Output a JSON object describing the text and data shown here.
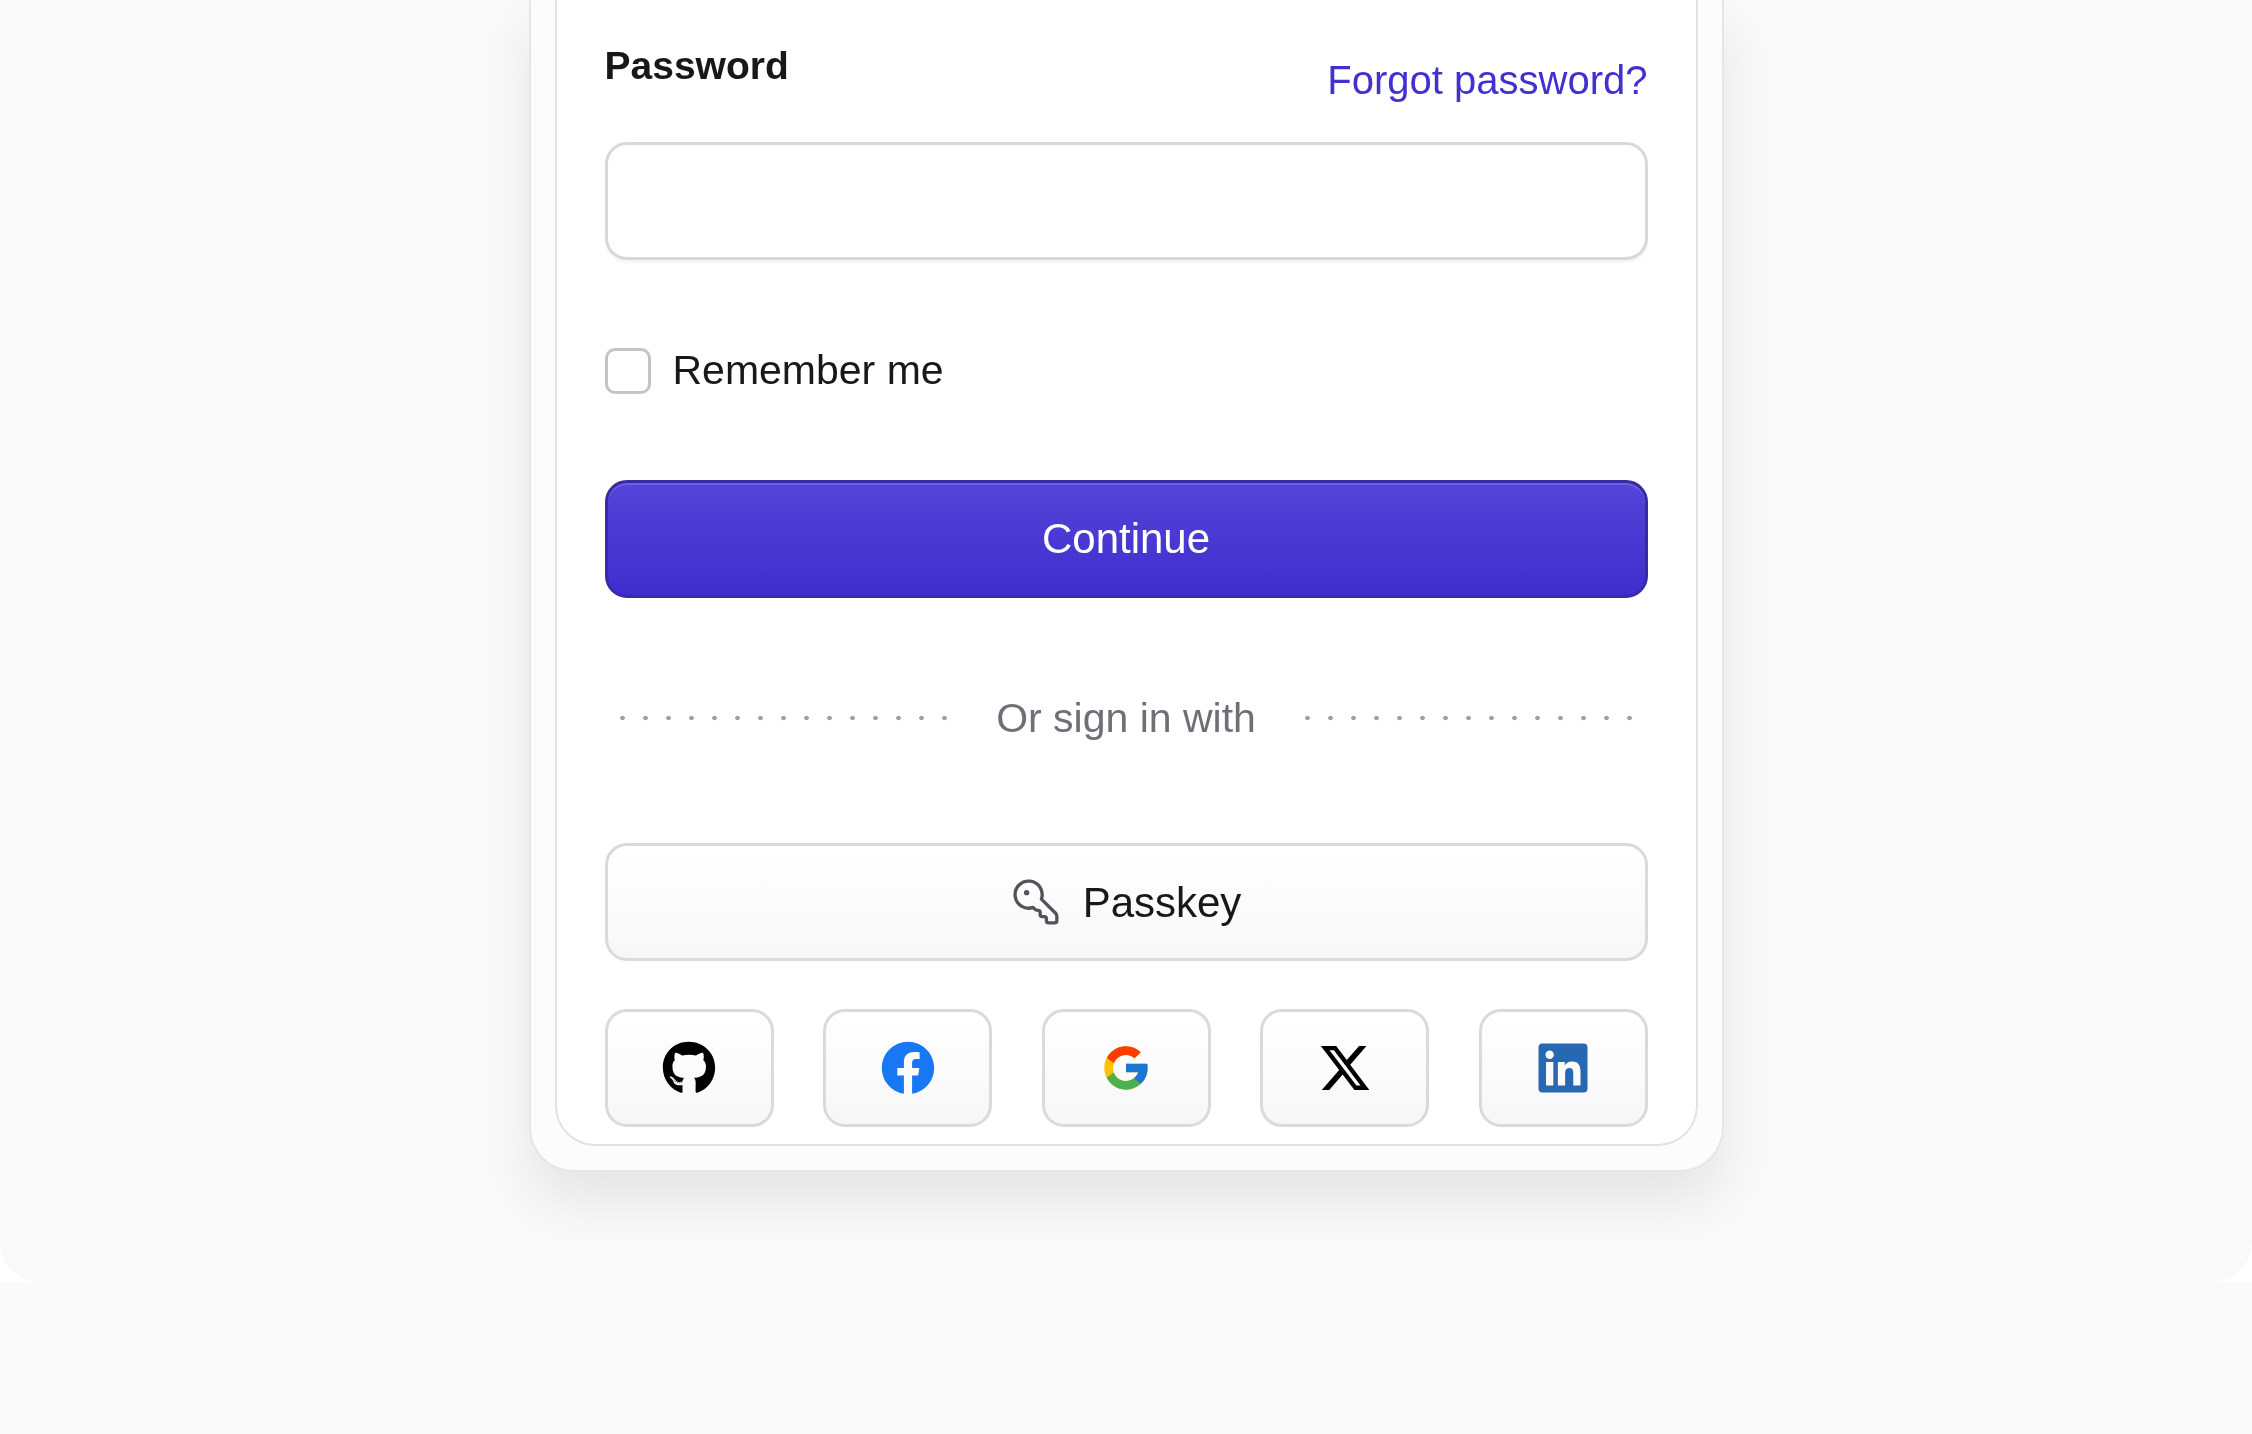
{
  "password": {
    "label": "Password",
    "forgot_link": "Forgot password?"
  },
  "remember": {
    "label": "Remember me",
    "checked": false
  },
  "continue_button": {
    "label": "Continue"
  },
  "divider": {
    "label": "Or sign in with"
  },
  "passkey_button": {
    "label": "Passkey"
  },
  "social_buttons": [
    {
      "kind": "github"
    },
    {
      "kind": "facebook"
    },
    {
      "kind": "google"
    },
    {
      "kind": "x"
    },
    {
      "kind": "linkedin"
    }
  ]
}
